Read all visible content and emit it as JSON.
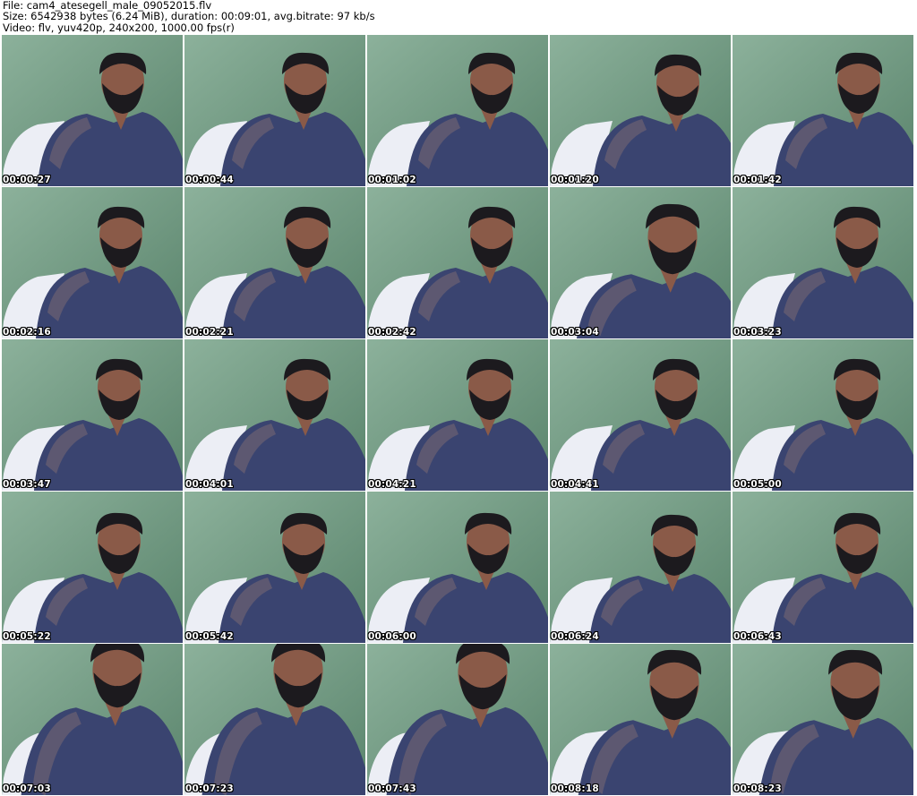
{
  "header": {
    "file_line": "File: cam4_atesegell_male_09052015.flv",
    "size_line": "Size: 6542938 bytes (6.24 MiB), duration: 00:09:01, avg.bitrate: 97 kb/s",
    "video_line": "Video: flv, yuv420p, 240x200, 1000.00 fps(r)"
  },
  "frames": [
    {
      "time": "00:00:27"
    },
    {
      "time": "00:00:44"
    },
    {
      "time": "00:01:02"
    },
    {
      "time": "00:01:20"
    },
    {
      "time": "00:01:42"
    },
    {
      "time": "00:02:16"
    },
    {
      "time": "00:02:21"
    },
    {
      "time": "00:02:42"
    },
    {
      "time": "00:03:04"
    },
    {
      "time": "00:03:23"
    },
    {
      "time": "00:03:47"
    },
    {
      "time": "00:04:01"
    },
    {
      "time": "00:04:21"
    },
    {
      "time": "00:04:41"
    },
    {
      "time": "00:05:00"
    },
    {
      "time": "00:05:22"
    },
    {
      "time": "00:05:42"
    },
    {
      "time": "00:06:00"
    },
    {
      "time": "00:06:24"
    },
    {
      "time": "00:06:43"
    },
    {
      "time": "00:07:03"
    },
    {
      "time": "00:07:23"
    },
    {
      "time": "00:07:43"
    },
    {
      "time": "00:08:18"
    },
    {
      "time": "00:08:23"
    }
  ],
  "colors": {
    "wall": "#6f9a82",
    "shirt": "#3a4470",
    "skin": "#8a5a48",
    "hair": "#1c1a1e",
    "pillow": "#f2f2fb"
  }
}
